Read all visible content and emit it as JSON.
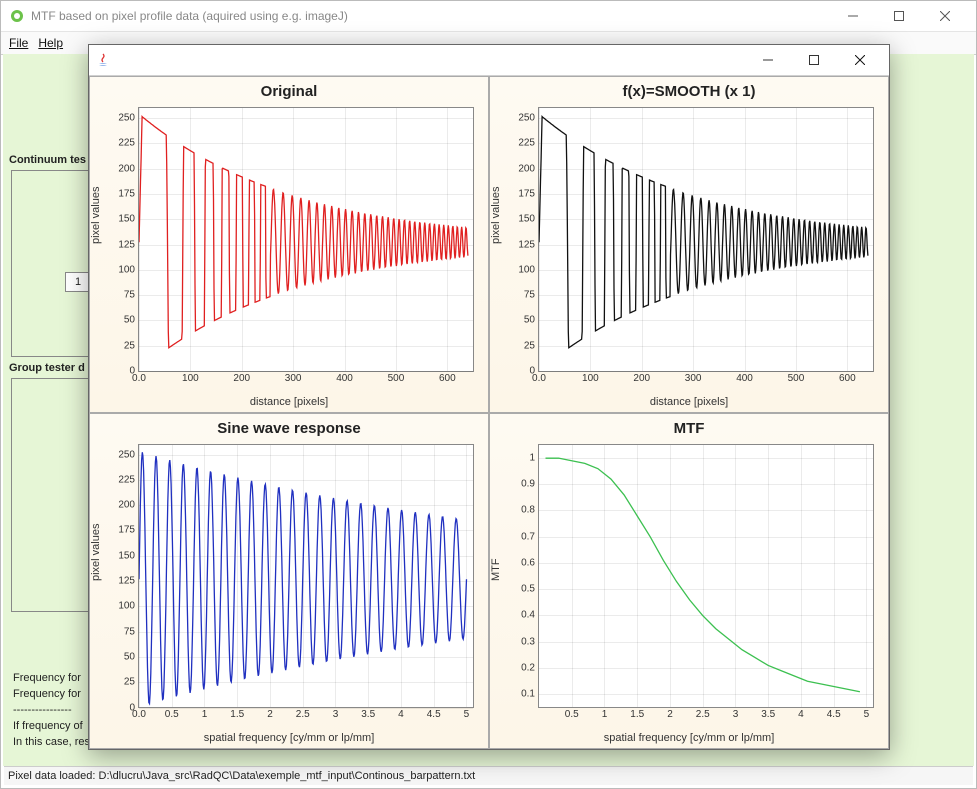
{
  "window": {
    "title": "MTF based on pixel profile data (aquired using e.g. imageJ)"
  },
  "menubar": {
    "file": "File",
    "help": "Help"
  },
  "background": {
    "label1": "Continuum tes",
    "label2": "Group tester d",
    "control_value": "1",
    "info_line1": "Frequency for",
    "info_line2": "Frequency for",
    "info_sep": "----------------",
    "info_line3": "If frequency of",
    "info_line4": "In this case, results are not concludent!"
  },
  "statusbar": {
    "text": "Pixel data loaded: D:\\dlucru\\Java_src\\RadQC\\Data\\exemple_mtf_input\\Continous_barpattern.txt"
  },
  "charts": {
    "c0": {
      "title": "Original",
      "xlabel": "distance [pixels]",
      "ylabel": "pixel values"
    },
    "c1": {
      "title": "f(x)=SMOOTH (x 1)",
      "xlabel": "distance [pixels]",
      "ylabel": "pixel values"
    },
    "c2": {
      "title": "Sine wave response",
      "xlabel": "spatial frequency [cy/mm or lp/mm]",
      "ylabel": "pixel values"
    },
    "c3": {
      "title": "MTF",
      "xlabel": "spatial frequency [cy/mm or lp/mm]",
      "ylabel": "MTF"
    }
  },
  "chart_data": [
    {
      "id": "c0",
      "type": "line",
      "title": "Original",
      "xlabel": "distance [pixels]",
      "ylabel": "pixel values",
      "xlim": [
        0,
        650
      ],
      "ylim": [
        0,
        260
      ],
      "xticks": [
        0,
        100,
        200,
        300,
        400,
        500,
        600
      ],
      "yticks": [
        0,
        25,
        50,
        75,
        100,
        125,
        150,
        175,
        200,
        225,
        250
      ],
      "color": "#e02020",
      "generator": "chirp",
      "params": {
        "N": 640,
        "mid": 127,
        "amp0": 127,
        "decay": 0.65,
        "f0": 0.4,
        "f1": 12
      }
    },
    {
      "id": "c1",
      "type": "line",
      "title": "f(x)=SMOOTH (x 1)",
      "xlabel": "distance [pixels]",
      "ylabel": "pixel values",
      "xlim": [
        0,
        650
      ],
      "ylim": [
        0,
        260
      ],
      "xticks": [
        0,
        100,
        200,
        300,
        400,
        500,
        600
      ],
      "yticks": [
        0,
        25,
        50,
        75,
        100,
        125,
        150,
        175,
        200,
        225,
        250
      ],
      "color": "#111111",
      "generator": "chirp",
      "params": {
        "N": 640,
        "mid": 127,
        "amp0": 127,
        "decay": 0.65,
        "f0": 0.4,
        "f1": 12
      }
    },
    {
      "id": "c2",
      "type": "line",
      "title": "Sine wave response",
      "xlabel": "spatial frequency [cy/mm or lp/mm]",
      "ylabel": "pixel values",
      "xlim": [
        0,
        5.1
      ],
      "ylim": [
        0,
        260
      ],
      "xticks": [
        0,
        0.5,
        1.0,
        1.5,
        2.0,
        2.5,
        3.0,
        3.5,
        4.0,
        4.5,
        5.0
      ],
      "yticks": [
        0,
        25,
        50,
        75,
        100,
        125,
        150,
        175,
        200,
        225,
        250
      ],
      "color": "#2030c0",
      "generator": "chirp_freq",
      "params": {
        "N": 500,
        "xmax": 5.0,
        "mid": 127,
        "amp0": 127,
        "decay": 0.88,
        "cycles": 24
      }
    },
    {
      "id": "c3",
      "type": "line",
      "title": "MTF",
      "xlabel": "spatial frequency [cy/mm or lp/mm]",
      "ylabel": "MTF",
      "xlim": [
        0,
        5.1
      ],
      "ylim": [
        0.05,
        1.05
      ],
      "xticks": [
        0.5,
        1.0,
        1.5,
        2.0,
        2.5,
        3.0,
        3.5,
        4.0,
        4.5,
        5.0
      ],
      "yticks": [
        0.1,
        0.2,
        0.3,
        0.4,
        0.5,
        0.6,
        0.7,
        0.8,
        0.9,
        1.0
      ],
      "color": "#3cc050",
      "generator": "points",
      "data": {
        "x": [
          0.1,
          0.3,
          0.5,
          0.7,
          0.9,
          1.1,
          1.3,
          1.5,
          1.7,
          1.9,
          2.1,
          2.3,
          2.5,
          2.7,
          2.9,
          3.1,
          3.3,
          3.5,
          3.7,
          3.9,
          4.1,
          4.3,
          4.5,
          4.7,
          4.9
        ],
        "y": [
          1.0,
          1.0,
          0.99,
          0.98,
          0.96,
          0.92,
          0.86,
          0.78,
          0.7,
          0.61,
          0.53,
          0.46,
          0.4,
          0.35,
          0.31,
          0.27,
          0.24,
          0.21,
          0.19,
          0.17,
          0.15,
          0.14,
          0.13,
          0.12,
          0.11
        ]
      }
    }
  ]
}
